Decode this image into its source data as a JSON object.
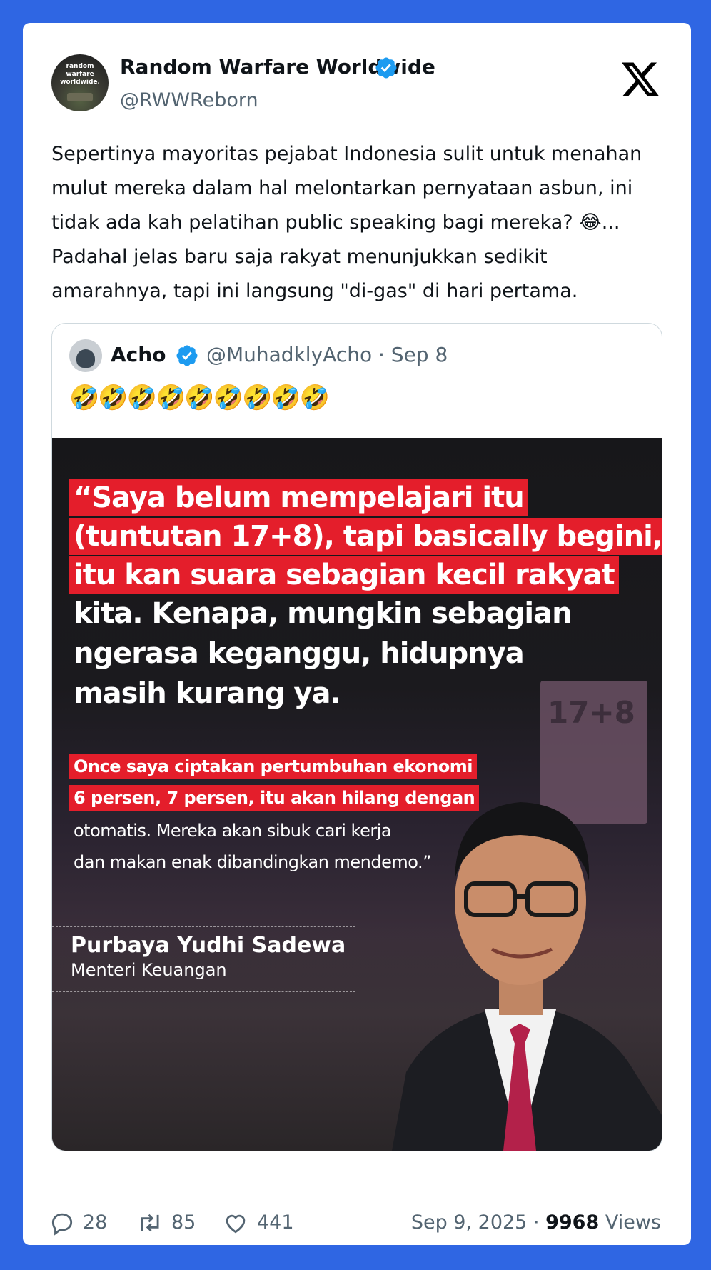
{
  "author": {
    "name": "Random Warfare Worldwide",
    "handle": "@RWWReborn",
    "avatar_text": "random warfare worldwide."
  },
  "tweet": {
    "lines": [
      "Sepertinya mayoritas pejabat Indonesia sulit untuk menahan",
      "mulut mereka dalam hal melontarkan pernyataan asbun, ini",
      "tidak ada kah pelatihan public speaking bagi mereka? 😂...",
      "Padahal jelas baru saja rakyat menunjukkan sedikit",
      "amarahnya, tapi ini langsung \"di-gas\" di hari pertama."
    ]
  },
  "quote": {
    "name": "Acho",
    "handle_date": "@MuhadklyAcho · Sep 8",
    "emoji": "🤣🤣🤣🤣🤣🤣🤣🤣🤣",
    "image": {
      "red_lines": [
        "“Saya belum mempelajari itu",
        "(tuntutan 17+8), tapi basically begini,",
        "itu kan suara sebagian kecil rakyat"
      ],
      "white_lines": [
        "kita. Kenapa, mungkin sebagian",
        "ngerasa keganggu, hidupnya",
        "masih kurang ya."
      ],
      "small_red_lines": [
        "Once saya ciptakan pertumbuhan ekonomi",
        "6 persen, 7 persen, itu akan hilang dengan"
      ],
      "small_white_lines": [
        "otomatis. Mereka akan sibuk cari kerja",
        "dan makan enak dibandingkan mendemo.”"
      ],
      "person_name": "Purbaya Yudhi Sadewa",
      "person_role": "Menteri Keuangan",
      "poster_text": "17+8"
    }
  },
  "footer": {
    "replies": "28",
    "retweets": "85",
    "likes": "441",
    "date": "Sep 9, 2025 · ",
    "views_count": "9968",
    "views_label": " Views"
  },
  "colors": {
    "background": "#2f66e3",
    "verified": "#1d9bf0",
    "highlight_red": "#e41e2b"
  }
}
